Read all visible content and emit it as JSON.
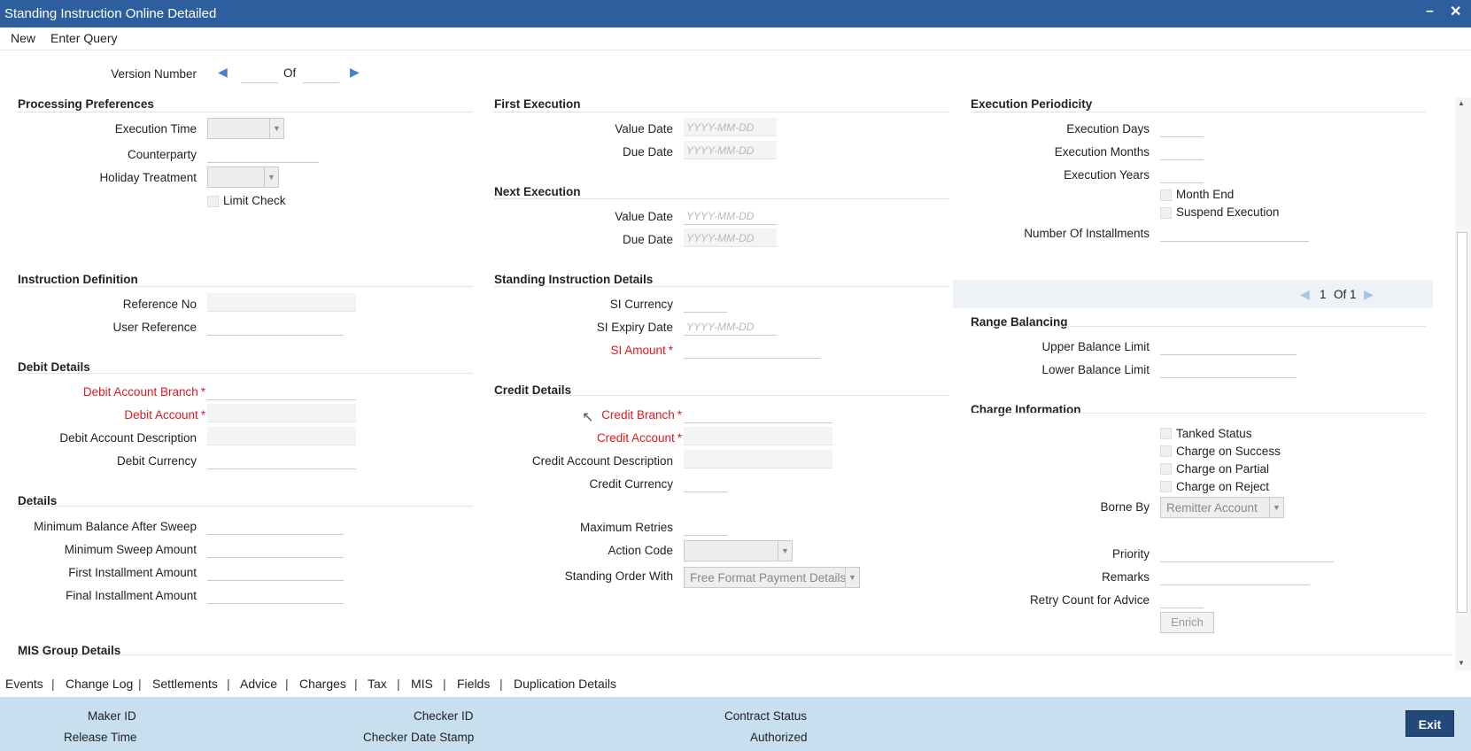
{
  "window": {
    "title": "Standing Instruction Online Detailed"
  },
  "menu": {
    "new": "New",
    "enter_query": "Enter Query"
  },
  "version": {
    "label": "Version Number",
    "of": "Of"
  },
  "placeholders": {
    "date": "YYYY-MM-DD"
  },
  "processing": {
    "title": "Processing Preferences",
    "execution_time": "Execution Time",
    "counterparty": "Counterparty",
    "holiday_treatment": "Holiday Treatment",
    "limit_check": "Limit Check"
  },
  "first_exec": {
    "title": "First Execution",
    "value_date": "Value Date",
    "due_date": "Due Date"
  },
  "next_exec": {
    "title": "Next Execution",
    "value_date": "Value Date",
    "due_date": "Due Date"
  },
  "periodicity": {
    "title": "Execution Periodicity",
    "days": "Execution Days",
    "months": "Execution Months",
    "years": "Execution Years",
    "month_end": "Month End",
    "suspend": "Suspend Execution",
    "installments": "Number Of Installments"
  },
  "pager": {
    "current": "1",
    "of": "Of",
    "total": "1"
  },
  "instruction": {
    "title": "Instruction Definition",
    "ref_no": "Reference No",
    "user_ref": "User Reference"
  },
  "si_details": {
    "title": "Standing Instruction Details",
    "currency": "SI Currency",
    "expiry": "SI Expiry Date",
    "amount": "SI Amount"
  },
  "range": {
    "title": "Range Balancing",
    "upper": "Upper Balance Limit",
    "lower": "Lower Balance Limit"
  },
  "debit": {
    "title": "Debit Details",
    "branch": "Debit Account Branch",
    "account": "Debit Account",
    "description": "Debit Account Description",
    "currency": "Debit Currency"
  },
  "credit": {
    "title": "Credit Details",
    "branch": "Credit Branch",
    "account": "Credit Account",
    "description": "Credit Account Description",
    "currency": "Credit Currency",
    "max_retries": "Maximum Retries",
    "action_code": "Action Code",
    "standing_order": "Standing Order With",
    "standing_order_value": "Free Format Payment Details"
  },
  "charge": {
    "title": "Charge Information",
    "tanked": "Tanked Status",
    "on_success": "Charge on Success",
    "on_partial": "Charge on Partial",
    "on_reject": "Charge on Reject",
    "borne_by": "Borne By",
    "borne_by_value": "Remitter Account",
    "priority": "Priority",
    "remarks": "Remarks",
    "retry_advice": "Retry Count for Advice",
    "enrich": "Enrich"
  },
  "details": {
    "title": "Details",
    "min_balance": "Minimum Balance After Sweep",
    "min_sweep": "Minimum Sweep Amount",
    "first_installment": "First Installment Amount",
    "final_installment": "Final Installment Amount"
  },
  "mis": {
    "title": "MIS Group Details"
  },
  "tabs": [
    "Events",
    "Change Log",
    "Settlements",
    "Advice",
    "Charges",
    "Tax",
    "MIS",
    "Fields",
    "Duplication Details"
  ],
  "audit": {
    "maker_id": "Maker ID",
    "release_time": "Release Time",
    "checker_id": "Checker ID",
    "checker_date": "Checker Date Stamp",
    "contract_status": "Contract Status",
    "authorized": "Authorized",
    "exit": "Exit"
  }
}
